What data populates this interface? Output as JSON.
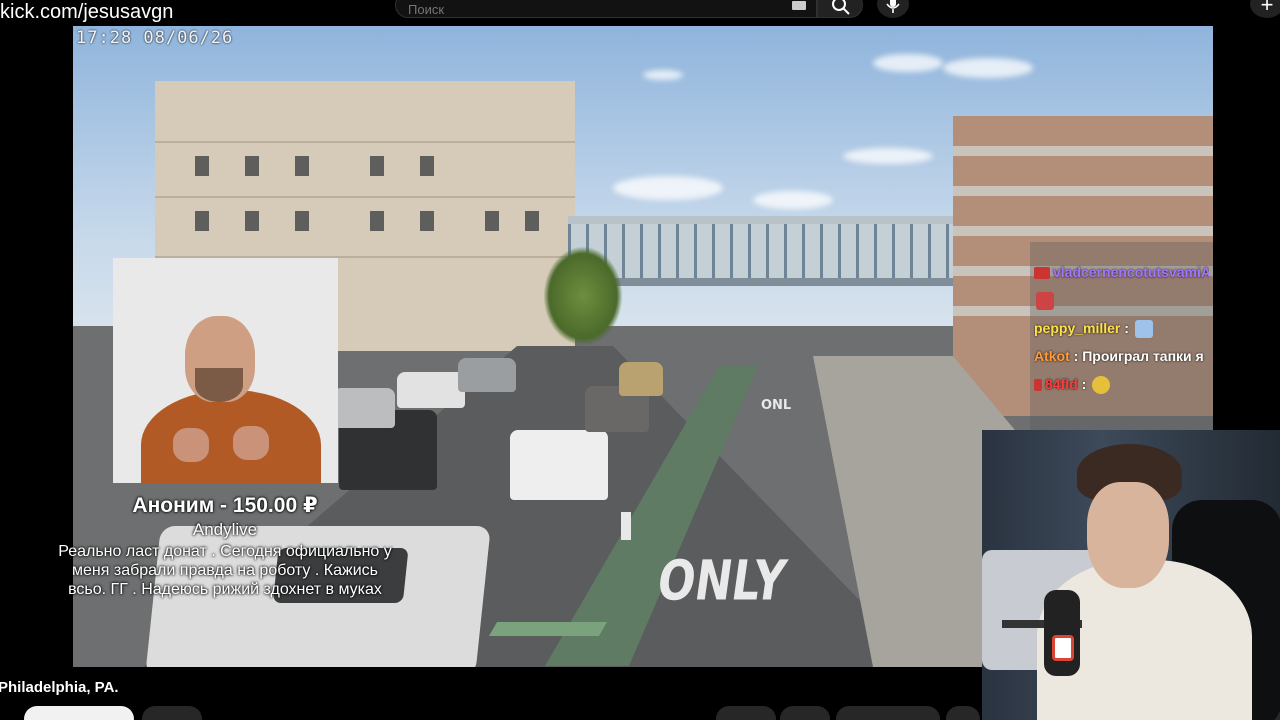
{
  "overlay": {
    "channel_url": "kick.com/jesusavgn"
  },
  "search": {
    "placeholder": "Поиск"
  },
  "video": {
    "timestamp": "17:28 08/06/26",
    "title": "Philadelphia, PA.",
    "road_marking_text": "ONLY",
    "road_marking_text_small": "ONL"
  },
  "donation": {
    "amount": "Аноним - 150.00 ₽",
    "name": "Andylive",
    "message": "Реально ласт донат . Сегодня официально у меня забрали правда на роботу . Кажись всьо. ГГ . Надеюсь рижий здохнет в муках"
  },
  "chat": {
    "messages": [
      {
        "user": "vladcernencotutsvamiAnudA",
        "text": ":",
        "color": "#a970ff"
      },
      {
        "user": "peppy_miller",
        "text": ":",
        "color": "#ffe14a"
      },
      {
        "user": "Atkot",
        "text": ": Проиграл тапки я",
        "color": "#ff9b3d"
      },
      {
        "user": "84fld",
        "text": ":",
        "color": "#ff3d3d"
      }
    ]
  },
  "colors": {
    "chat_purple": "#a970ff",
    "chat_yellow": "#ffe14a",
    "chat_orange": "#ff9b3d"
  },
  "icons": {
    "search": "search-icon",
    "mic": "microphone-icon",
    "create": "plus-icon",
    "keyboard": "keyboard-icon"
  }
}
